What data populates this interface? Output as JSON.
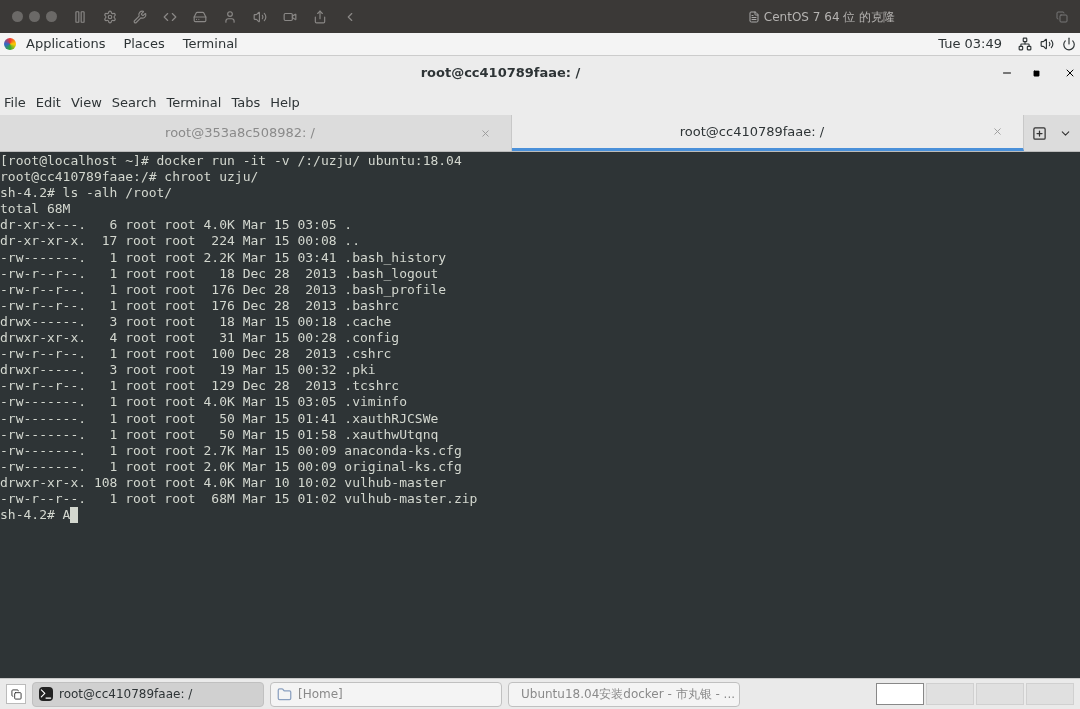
{
  "vm_toolbar": {
    "title": "CentOS 7 64 位 的克隆"
  },
  "top_bar": {
    "menus": [
      "Applications",
      "Places",
      "Terminal"
    ],
    "clock": "Tue 03:49"
  },
  "window": {
    "title": "root@cc410789faae: /"
  },
  "menu_bar": [
    "File",
    "Edit",
    "View",
    "Search",
    "Terminal",
    "Tabs",
    "Help"
  ],
  "tabs": [
    {
      "label": "root@353a8c508982: /",
      "selected": false
    },
    {
      "label": "root@cc410789faae: /",
      "selected": true
    }
  ],
  "terminal": {
    "lines": [
      "[root@localhost ~]# docker run -it -v /:/uzju/ ubuntu:18.04",
      "root@cc410789faae:/# chroot uzju/",
      "sh-4.2# ls -alh /root/",
      "total 68M",
      "dr-xr-x---.   6 root root 4.0K Mar 15 03:05 .",
      "dr-xr-xr-x.  17 root root  224 Mar 15 00:08 ..",
      "-rw-------.   1 root root 2.2K Mar 15 03:41 .bash_history",
      "-rw-r--r--.   1 root root   18 Dec 28  2013 .bash_logout",
      "-rw-r--r--.   1 root root  176 Dec 28  2013 .bash_profile",
      "-rw-r--r--.   1 root root  176 Dec 28  2013 .bashrc",
      "drwx------.   3 root root   18 Mar 15 00:18 .cache",
      "drwxr-xr-x.   4 root root   31 Mar 15 00:28 .config",
      "-rw-r--r--.   1 root root  100 Dec 28  2013 .cshrc",
      "drwxr-----.   3 root root   19 Mar 15 00:32 .pki",
      "-rw-r--r--.   1 root root  129 Dec 28  2013 .tcshrc",
      "-rw-------.   1 root root 4.0K Mar 15 03:05 .viminfo",
      "-rw-------.   1 root root   50 Mar 15 01:41 .xauthRJCSWe",
      "-rw-------.   1 root root   50 Mar 15 01:58 .xauthwUtqnq",
      "-rw-------.   1 root root 2.7K Mar 15 00:09 anaconda-ks.cfg",
      "-rw-------.   1 root root 2.0K Mar 15 00:09 original-ks.cfg",
      "drwxr-xr-x. 108 root root 4.0K Mar 10 10:02 vulhub-master",
      "-rw-r--r--.   1 root root  68M Mar 15 01:02 vulhub-master.zip",
      "sh-4.2# A"
    ],
    "cursor_visible": true
  },
  "taskbar": {
    "tasks": [
      {
        "kind": "terminal",
        "label": "root@cc410789faae: /",
        "selected": true
      },
      {
        "kind": "files",
        "label": "[Home]",
        "selected": false
      },
      {
        "kind": "browser",
        "label": "Ubuntu18.04安装docker - 市丸银 - ...",
        "selected": false
      }
    ],
    "workspaces": [
      {
        "selected": true
      },
      {
        "selected": false
      },
      {
        "selected": false
      },
      {
        "selected": false
      }
    ]
  }
}
